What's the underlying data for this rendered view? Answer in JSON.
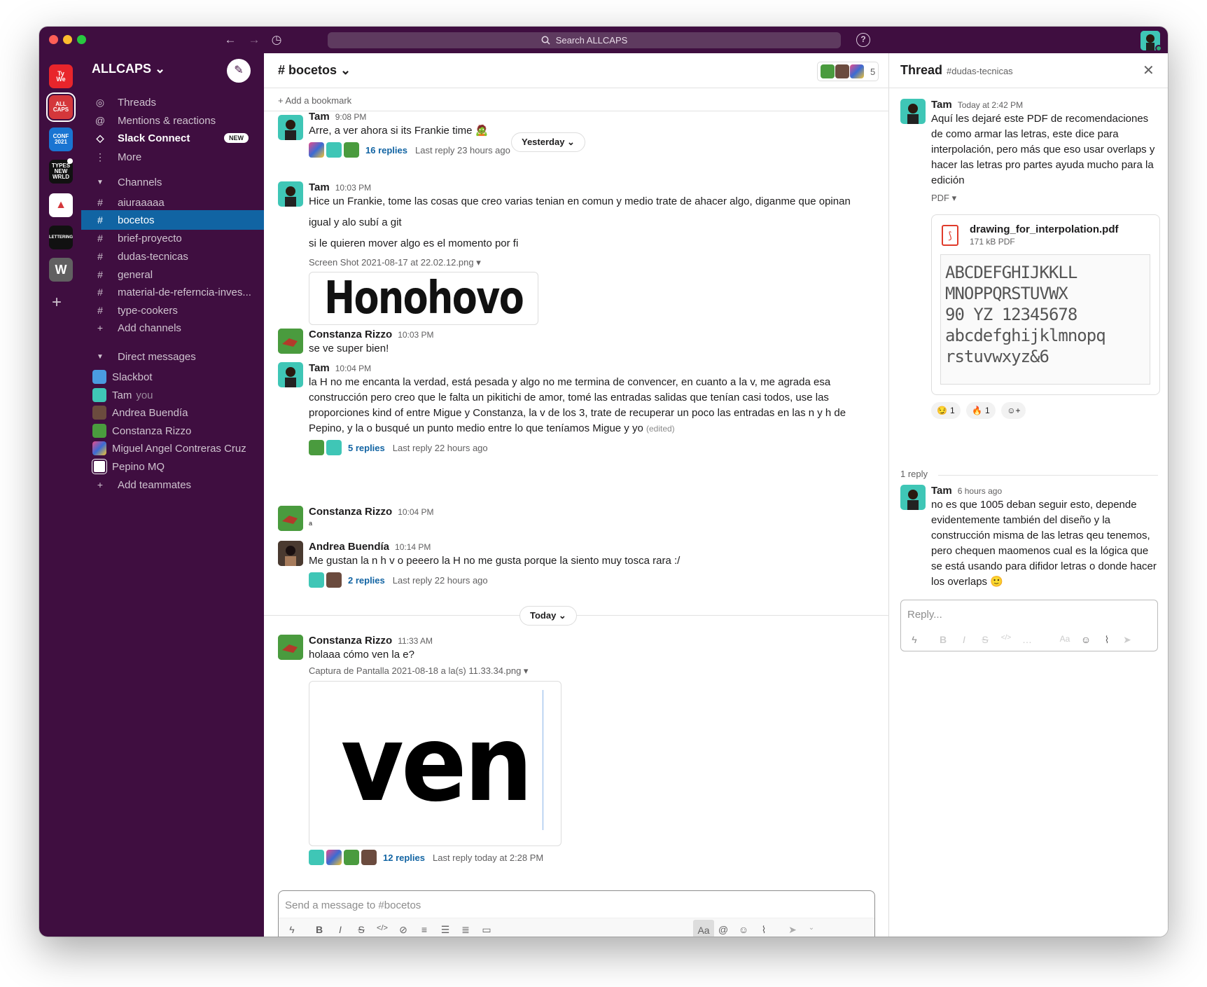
{
  "app": {
    "search_placeholder": "Search ALLCAPS",
    "help_label": "?"
  },
  "workspaces": [
    {
      "label": "Type Week",
      "color": "#e8252b"
    },
    {
      "label": "ALL CAPS",
      "color": "#d4373b"
    },
    {
      "label": "Conference 2021",
      "color": "#1a75d2"
    },
    {
      "label": "TYPES NEW WORLD",
      "color": "#111111"
    },
    {
      "label": "Hat",
      "color": "#ffffff"
    },
    {
      "label": "LETTERING",
      "color": "#111111"
    },
    {
      "label": "W",
      "color": "#616061"
    }
  ],
  "sidebar": {
    "workspace_name": "ALLCAPS ⌄",
    "nav": [
      {
        "label": "Threads",
        "icon": "threads-icon"
      },
      {
        "label": "Mentions & reactions",
        "icon": "at-icon"
      },
      {
        "label": "Slack Connect",
        "icon": "connect-icon",
        "badge": "NEW"
      },
      {
        "label": "More",
        "icon": "more-icon"
      }
    ],
    "channels_header": "Channels",
    "channels": [
      "aiuraaaaa",
      "bocetos",
      "brief-proyecto",
      "dudas-tecnicas",
      "general",
      "material-de-referncia-inves...",
      "type-cookers"
    ],
    "add_channels": "Add channels",
    "dm_header": "Direct messages",
    "dms": [
      {
        "name": "Slackbot",
        "color": "#4a9be0"
      },
      {
        "name": "Tam",
        "extra": "you",
        "color": "#3fc6b6"
      },
      {
        "name": "Andrea Buendía",
        "color": "#6b4b3e"
      },
      {
        "name": "Constanza Rizzo",
        "color": "#4a9b3e"
      },
      {
        "name": "Miguel Angel Contreras Cruz",
        "color": "#e84c8a"
      },
      {
        "name": "Pepino MQ",
        "color": "#ffffff"
      }
    ],
    "add_teammates": "Add teammates"
  },
  "channel": {
    "title": "# bocetos ⌄",
    "member_count": "5",
    "bookmark": "+  Add a bookmark",
    "messages": [
      {
        "name": "Tam",
        "time": "9:08 PM",
        "lines": [
          "Arre, a ver ahora si its Frankie time 🧟"
        ],
        "replies": "16 replies",
        "last": "Last reply 23 hours ago"
      },
      {
        "name": "Tam",
        "time": "10:03 PM",
        "lines": [
          "Hice un Frankie, tome las cosas que creo varias tenian en comun y medio trate de ahacer algo, diganme que opinan",
          "igual y alo subí a git",
          "si le quieren mover algo es el momento por fi"
        ],
        "file": "Screen Shot 2021-08-17 at 22.02.12.png",
        "image_text": "Honohovo"
      },
      {
        "name": "Constanza Rizzo",
        "time": "10:03 PM",
        "lines": [
          "se ve super bien!"
        ]
      },
      {
        "name": "Tam",
        "time": "10:04 PM",
        "lines": [
          "la H no me encanta la verdad, está pesada y algo no me termina de convencer, en cuanto a la v, me agrada esa construcción pero creo que le falta un pikitichi de amor, tomé las entradas salidas que tenían casi todos, use las proporciones kind of entre Migue y Constanza, la v de los 3, trate de recuperar un poco las entradas en las n y h de Pepino, y la o busqué un punto medio entre lo que teníamos Migue y yo"
        ],
        "edited": "(edited)",
        "replies": "5 replies",
        "last": "Last reply 22 hours ago"
      },
      {
        "name": "Constanza Rizzo",
        "time": "10:04 PM",
        "lines": [
          "a"
        ]
      },
      {
        "name": "Andrea Buendía",
        "time": "10:14 PM",
        "lines": [
          "Me gustan la n h v o peeero la H no me gusta porque la siento muy tosca rara :/"
        ],
        "replies": "2 replies",
        "last": "Last reply 22 hours ago"
      },
      {
        "name": "Constanza Rizzo",
        "time": "11:33 AM",
        "lines": [
          "holaaa cómo ven la e?"
        ],
        "file": "Captura de Pantalla 2021-08-18 a la(s) 11.33.34.png",
        "image_text": "ven",
        "replies": "12 replies",
        "last": "Last reply today at 2:28 PM"
      }
    ],
    "date_yesterday": "Yesterday ⌄",
    "date_today": "Today ⌄",
    "composer_placeholder": "Send a message to #bocetos"
  },
  "thread": {
    "title": "Thread",
    "channel": "#dudas-tecnicas",
    "parent": {
      "name": "Tam",
      "time": "Today at 2:42 PM",
      "text": "Aquí les dejaré este PDF de recomendaciones de como armar las letras, este dice para interpolación, pero más que eso usar overlaps y hacer las letras pro partes ayuda mucho para la edición",
      "file_type": "PDF ▾",
      "file_name": "drawing_for_interpolation.pdf",
      "file_meta": "171 kB PDF",
      "preview_lines": [
        "ABCDEFGHIJKKLL",
        "MNOPPQRSTUVWX",
        "90 YZ 12345678",
        "abcdefghijklmnopq",
        "rstuvwxyz&6"
      ],
      "reactions": [
        {
          "emoji": "😏",
          "count": "1"
        },
        {
          "emoji": "🔥",
          "count": "1"
        }
      ]
    },
    "reply_count": "1 reply",
    "reply": {
      "name": "Tam",
      "time": "6 hours ago",
      "text": "no es que 1005 deban seguir esto, depende evidentemente también del diseño y la construcción misma de las letras qeu tenemos, pero chequen maomenos cual es la lógica que se está usando para difidor letras o donde hacer los overlaps 🙂"
    },
    "reply_placeholder": "Reply..."
  }
}
